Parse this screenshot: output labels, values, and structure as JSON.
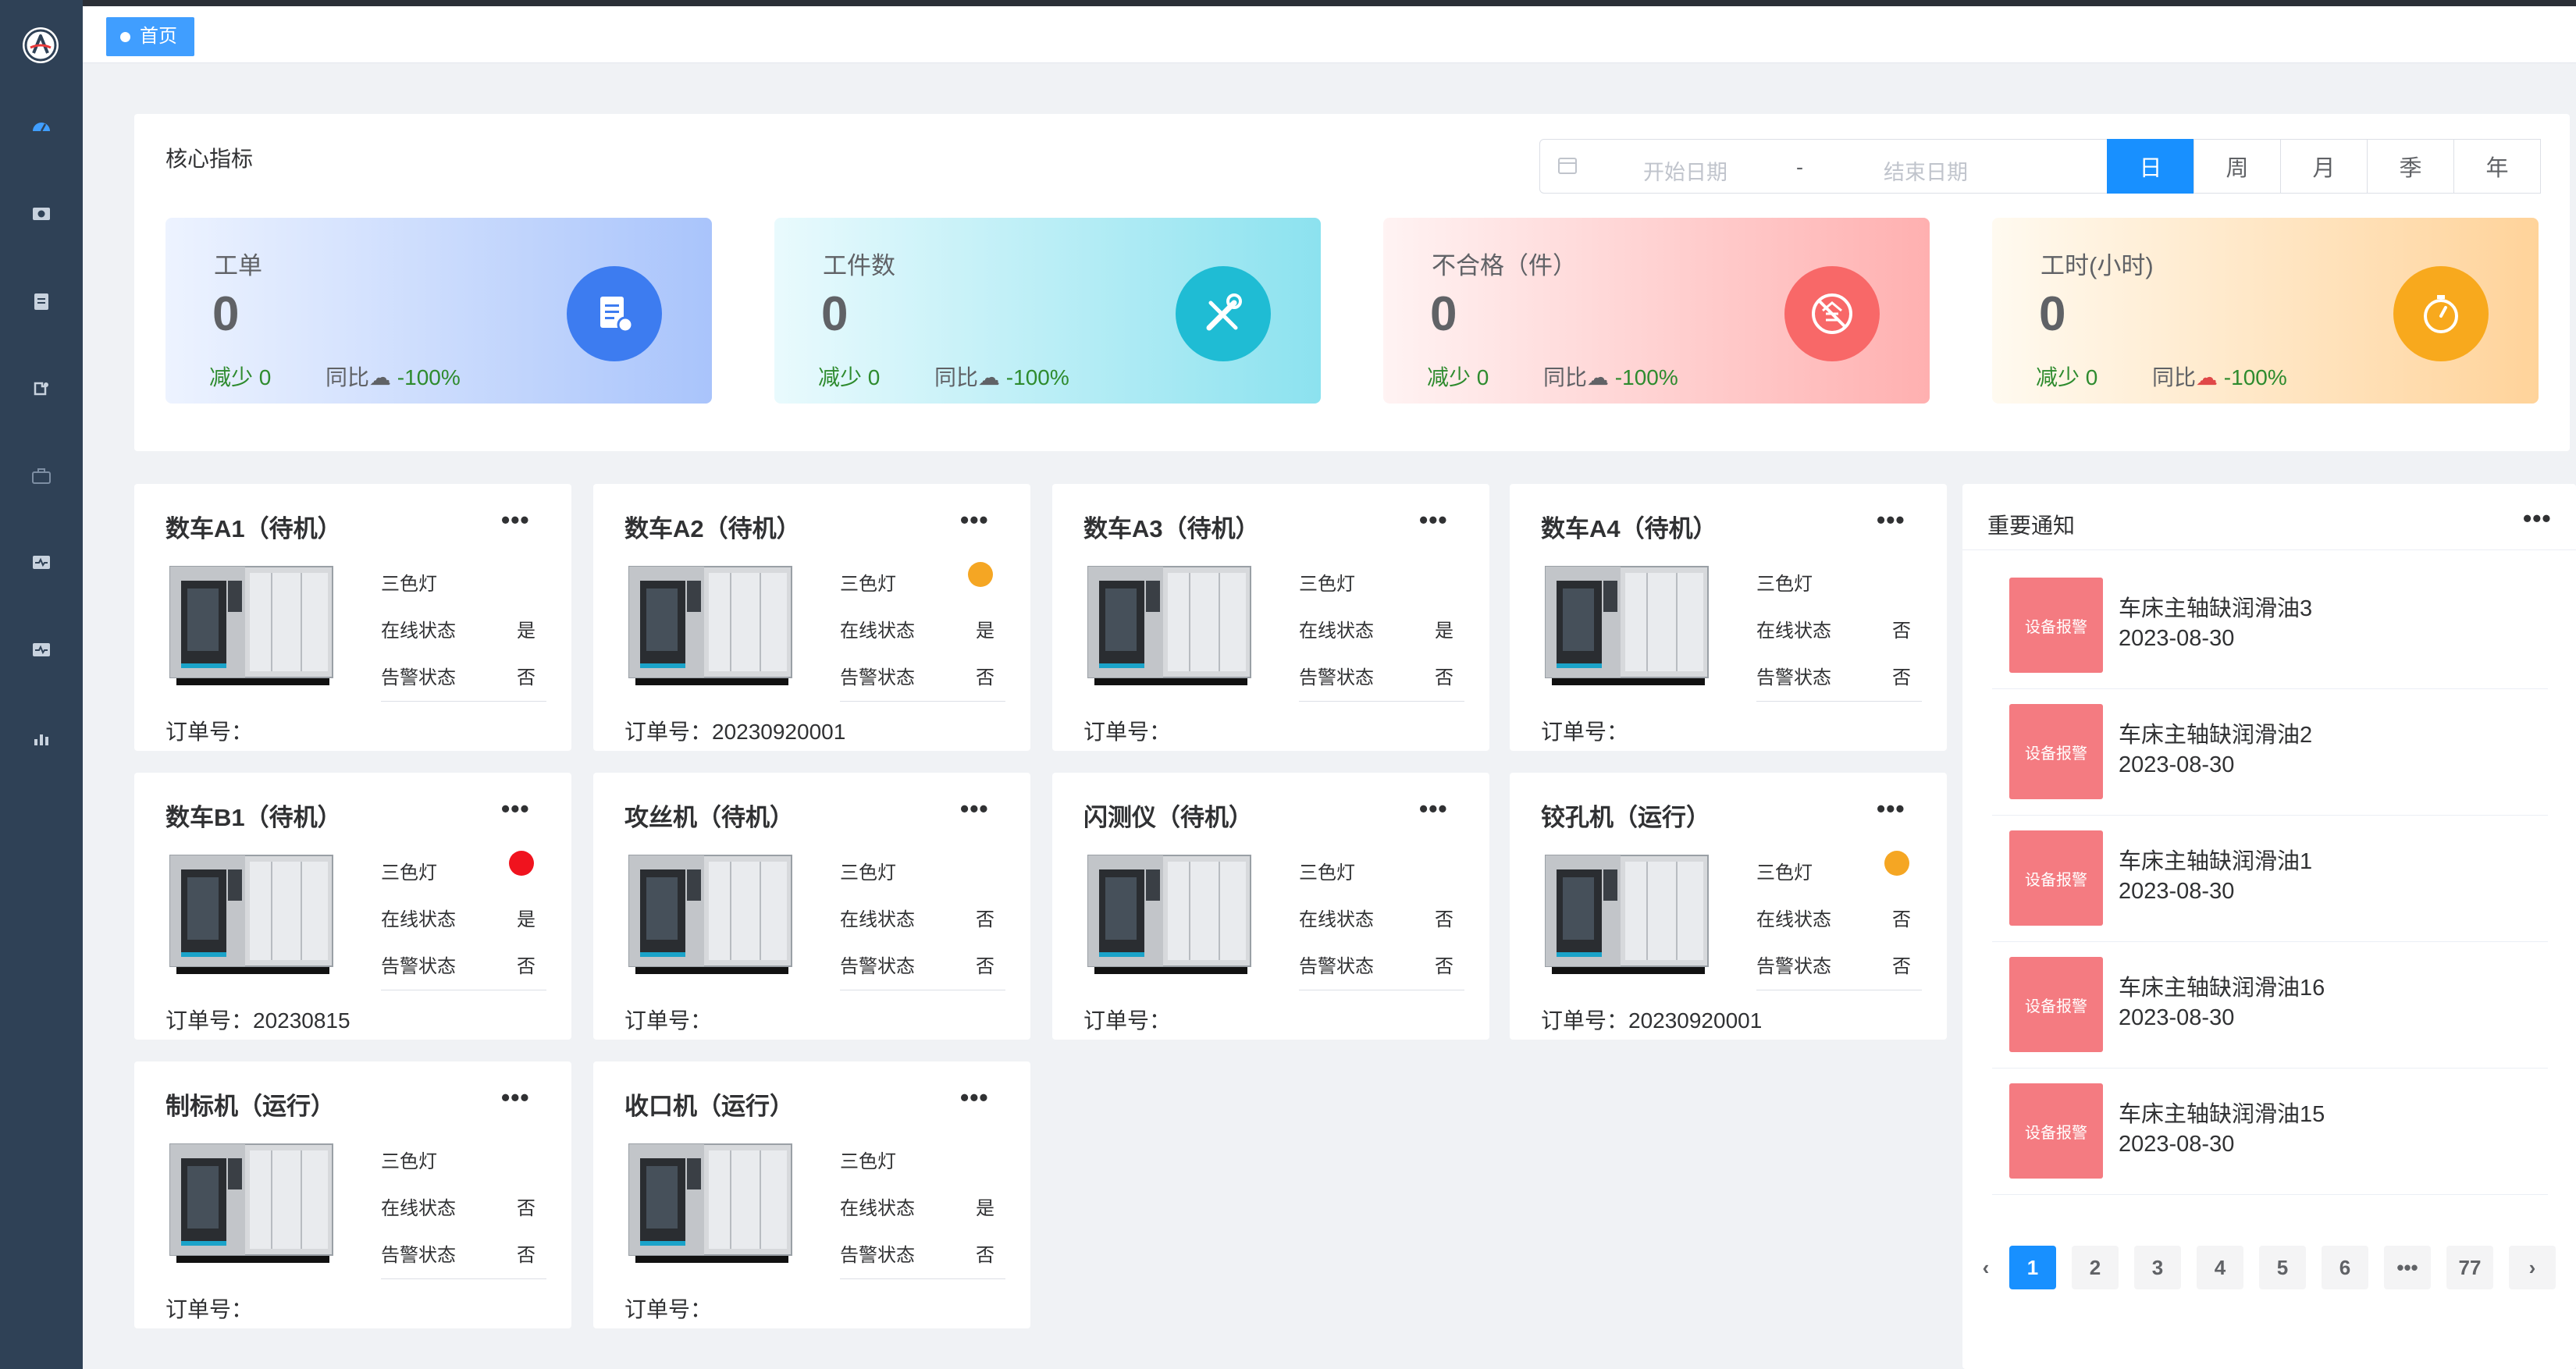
{
  "sidebar": {
    "icons": [
      "logo-icon",
      "dashboard-icon",
      "camera-icon",
      "clipboard-icon",
      "plugin-icon",
      "briefcase-icon",
      "monitor-pulse-icon",
      "monitor-pulse-icon",
      "chart-icon"
    ]
  },
  "tab": {
    "label": "首页"
  },
  "core": {
    "title": "核心指标",
    "date_start_placeholder": "开始日期",
    "date_sep": "-",
    "date_end_placeholder": "结束日期",
    "periods": [
      "日",
      "周",
      "月",
      "季",
      "年"
    ],
    "active_period": "日",
    "kpis": [
      {
        "title": "工单",
        "value": "0",
        "decrease": "减少 0",
        "yoy_label": "同比",
        "yoy_value": "-100%",
        "icon": "work-order-icon",
        "color": "#3d7cf0"
      },
      {
        "title": "工件数",
        "value": "0",
        "decrease": "减少 0",
        "yoy_label": "同比",
        "yoy_value": "-100%",
        "icon": "tools-icon",
        "color": "#1fbcd4"
      },
      {
        "title": "不合格（件）",
        "value": "0",
        "decrease": "减少 0",
        "yoy_label": "同比",
        "yoy_value": "-100%",
        "icon": "reject-icon",
        "color": "#f86868"
      },
      {
        "title": "工时(小时)",
        "value": "0",
        "decrease": "减少 0",
        "yoy_label": "同比",
        "yoy_value": "-100%",
        "icon": "stopwatch-icon",
        "color": "#f8a91d"
      }
    ]
  },
  "machine_labels": {
    "light": "三色灯",
    "online": "在线状态",
    "alarm": "告警状态",
    "order": "订单号：",
    "more": "•••"
  },
  "machines": [
    {
      "name": "数车A1（待机）",
      "light": "",
      "online": "是",
      "alarm": "否",
      "order": ""
    },
    {
      "name": "数车A2（待机）",
      "light": "#f5a623",
      "online": "是",
      "alarm": "否",
      "order": "20230920001"
    },
    {
      "name": "数车A3（待机）",
      "light": "",
      "online": "是",
      "alarm": "否",
      "order": ""
    },
    {
      "name": "数车A4（待机）",
      "light": "",
      "online": "否",
      "alarm": "否",
      "order": ""
    },
    {
      "name": "数车B1（待机）",
      "light": "#f0131e",
      "online": "是",
      "alarm": "否",
      "order": "20230815"
    },
    {
      "name": "攻丝机（待机）",
      "light": "",
      "online": "否",
      "alarm": "否",
      "order": ""
    },
    {
      "name": "闪测仪（待机）",
      "light": "",
      "online": "否",
      "alarm": "否",
      "order": ""
    },
    {
      "name": "铰孔机（运行）",
      "light": "#f5a623",
      "online": "否",
      "alarm": "否",
      "order": "20230920001"
    },
    {
      "name": "制标机（运行）",
      "light": "",
      "online": "否",
      "alarm": "否",
      "order": ""
    },
    {
      "name": "收口机（运行）",
      "light": "",
      "online": "是",
      "alarm": "否",
      "order": ""
    }
  ],
  "notice": {
    "title": "重要通知",
    "more": "•••",
    "items": [
      {
        "badge": "设备报警",
        "text": "车床主轴缺润滑油3",
        "date": "2023-08-30"
      },
      {
        "badge": "设备报警",
        "text": "车床主轴缺润滑油2",
        "date": "2023-08-30"
      },
      {
        "badge": "设备报警",
        "text": "车床主轴缺润滑油1",
        "date": "2023-08-30"
      },
      {
        "badge": "设备报警",
        "text": "车床主轴缺润滑油16",
        "date": "2023-08-30"
      },
      {
        "badge": "设备报警",
        "text": "车床主轴缺润滑油15",
        "date": "2023-08-30"
      }
    ],
    "pager": {
      "prev": "‹",
      "pages": [
        "1",
        "2",
        "3",
        "4",
        "5",
        "6",
        "•••",
        "77"
      ],
      "next": "›",
      "current": "1"
    }
  }
}
